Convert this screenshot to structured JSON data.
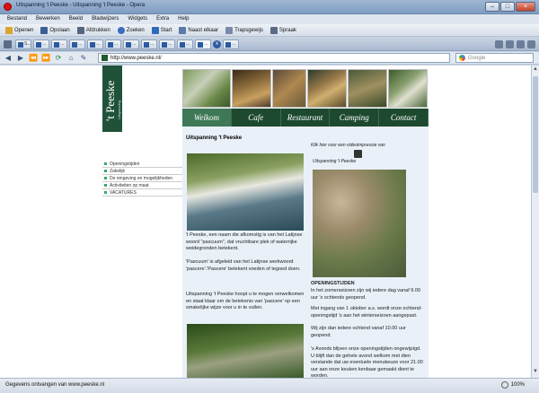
{
  "window": {
    "title": "Uitspanning 't Peeske - Uitspanning 't Peeske - Opera"
  },
  "menu": [
    "Bestand",
    "Bewerken",
    "Beeld",
    "Bladwijzers",
    "Widgets",
    "Extra",
    "Help"
  ],
  "toolbar": [
    {
      "label": "Openen",
      "icon": "folder-icon",
      "color": "#d9a531"
    },
    {
      "label": "Opslaan",
      "icon": "disk-icon",
      "color": "#3b5f95"
    },
    {
      "label": "Afdrukken",
      "icon": "printer-icon",
      "color": "#54667f"
    },
    {
      "label": "Zoeken",
      "icon": "magnifier-icon",
      "color": "#3a6fbf"
    },
    {
      "label": "Start",
      "icon": "home-icon",
      "color": "#2c6bb8"
    },
    {
      "label": "Naast elkaar",
      "icon": "tile-icon",
      "color": "#5a7aa8"
    },
    {
      "label": "Trapsgewijs",
      "icon": "cascade-icon",
      "color": "#7a8aa8"
    },
    {
      "label": "Spraak",
      "icon": "voice-icon",
      "color": "#5a6a84"
    }
  ],
  "tabs": [
    {
      "label": "S..."
    },
    {
      "label": "..."
    },
    {
      "label": "..."
    },
    {
      "label": "..."
    },
    {
      "label": "..."
    },
    {
      "label": "..."
    },
    {
      "label": "..."
    },
    {
      "label": "..."
    },
    {
      "label": "..."
    },
    {
      "label": "..."
    },
    {
      "label": "..."
    },
    {
      "label": "..."
    }
  ],
  "address": {
    "url": "http://www.peeske.nl/",
    "search_placeholder": "Google"
  },
  "site": {
    "logo_word": "'t Peeske",
    "logo_sub": "Uitspanning",
    "nav": [
      "Welkom",
      "Cafe",
      "Restaurant",
      "Camping",
      "Contact"
    ],
    "nav_active": 0,
    "sidebar": [
      "Openingstijden",
      "Zakelijk",
      "De omgeving en mogelijkheden",
      "Activiteiten op maat",
      "VACATURES"
    ],
    "heading": "Uitspanning 't Peeske",
    "video_caption": "Klik hier voor een videoimpressie van",
    "video_caption2": "Uitspanning 't Peeske",
    "para1": "'t Peeske, een naam die afkomstig is van het Latijnse woord \"pascuum\", dat vruchtbare plek of waterrijke weidegronden betekent.",
    "para2": "'Pascuum' is afgeleid van het Latijnse werkwoord 'pascere'.'Pascere' betekent voeden of tegoed doen.",
    "para3": "Uitspanning 't Peeske  hoopt u te mogen verwelkomen en staat klaar om de betekenis van 'pascere' op een smakelijke wijze voor u in te vullen.",
    "open_title": "OPENINGSTIJDEN",
    "open1": "In het zomerseizoen zijn wij iedere dag vanaf 9.00 uur  's ochtends geopend.",
    "open2": "Met ingang van 1 oktober a.s. wordt onze ochtend-openingstijd 's aan het winterseizoen aangepast.",
    "open3": "Wij zijn dan iedere ochtend vanaf 10.00 uur geopend.",
    "open4": "'s Avonds blijven onze openingstijden ongewijzigd. U blijft dan de gehele avond welkom met dien verstande dat uw eventuele menukeuze voor 21.00 uur aan onze keuken kenbaar gemaakt dient te worden."
  },
  "status": {
    "text": "Gegevens ontvangen van www.peeske.nl",
    "zoom": "100%"
  }
}
